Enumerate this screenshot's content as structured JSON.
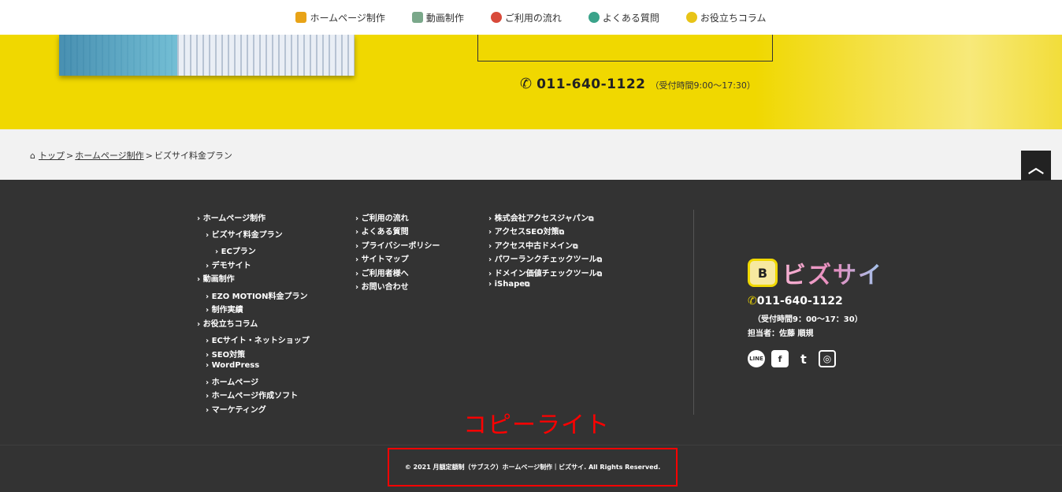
{
  "nav": {
    "items": [
      {
        "label": "ホームページ制作",
        "icon": "homepage-icon",
        "color": "#e8a317"
      },
      {
        "label": "動画制作",
        "icon": "video-icon",
        "color": "#7aa88a"
      },
      {
        "label": "ご利用の流れ",
        "icon": "flow-icon",
        "color": "#d84a3a"
      },
      {
        "label": "よくある質問",
        "icon": "question-icon",
        "color": "#3aa38a"
      },
      {
        "label": "お役立ちコラム",
        "icon": "column-icon",
        "color": "#e8c417"
      }
    ]
  },
  "hero": {
    "phone_number": "011-640-1122",
    "hours": "（受付時間9:00～17:30）"
  },
  "breadcrumb": {
    "items": [
      "トップ",
      "ホームページ制作"
    ],
    "separator": ">",
    "current": "ビズサイ料金プラン"
  },
  "footer": {
    "col1": [
      {
        "label": "ホームページ制作"
      },
      {
        "label": "ビズサイ料金プラン"
      },
      {
        "label": "ECプラン"
      },
      {
        "label": "デモサイト"
      },
      {
        "label": "動画制作"
      },
      {
        "label": "EZO MOTION料金プラン"
      },
      {
        "label": "制作実績"
      },
      {
        "label": "お役立ちコラム"
      },
      {
        "label": "ECサイト・ネットショップ"
      },
      {
        "label": "SEO対策"
      },
      {
        "label": "WordPress"
      },
      {
        "label": "ホームページ"
      },
      {
        "label": "ホームページ作成ソフト"
      },
      {
        "label": "マーケティング"
      }
    ],
    "col2": [
      {
        "label": "ご利用の流れ"
      },
      {
        "label": "よくある質問"
      },
      {
        "label": "プライバシーポリシー"
      },
      {
        "label": "サイトマップ"
      },
      {
        "label": "ご利用者様へ"
      },
      {
        "label": "お問い合わせ"
      }
    ],
    "col3": [
      {
        "label": "株式会社アクセスジャパン"
      },
      {
        "label": "アクセスSEO対策"
      },
      {
        "label": "アクセス中古ドメイン"
      },
      {
        "label": "パワーランクチェックツール"
      },
      {
        "label": "ドメイン価値チェックツール"
      },
      {
        "label": "iShape"
      }
    ],
    "brand": {
      "logo_letter": "B",
      "logo_text": "ビズサイ",
      "phone": "011-640-1122",
      "hours": "（受付時間9：00～17：30）",
      "contact": "担当者：佐藤 順規"
    },
    "social": [
      {
        "name": "line-icon",
        "glyph": "LINE"
      },
      {
        "name": "facebook-icon",
        "glyph": "f"
      },
      {
        "name": "twitter-icon",
        "glyph": "t"
      },
      {
        "name": "instagram-icon",
        "glyph": "◎"
      }
    ]
  },
  "annotation": "コピーライト",
  "copyright": "© 2021 月額定額制（サブスク）ホームページ制作｜ビズサイ. All Rights Reserved.",
  "colors": {
    "hero_yellow": "#f0d800",
    "footer_bg": "#333333",
    "breadcrumb_bg": "#f2f2f2",
    "annotation_red": "#ff0000"
  }
}
